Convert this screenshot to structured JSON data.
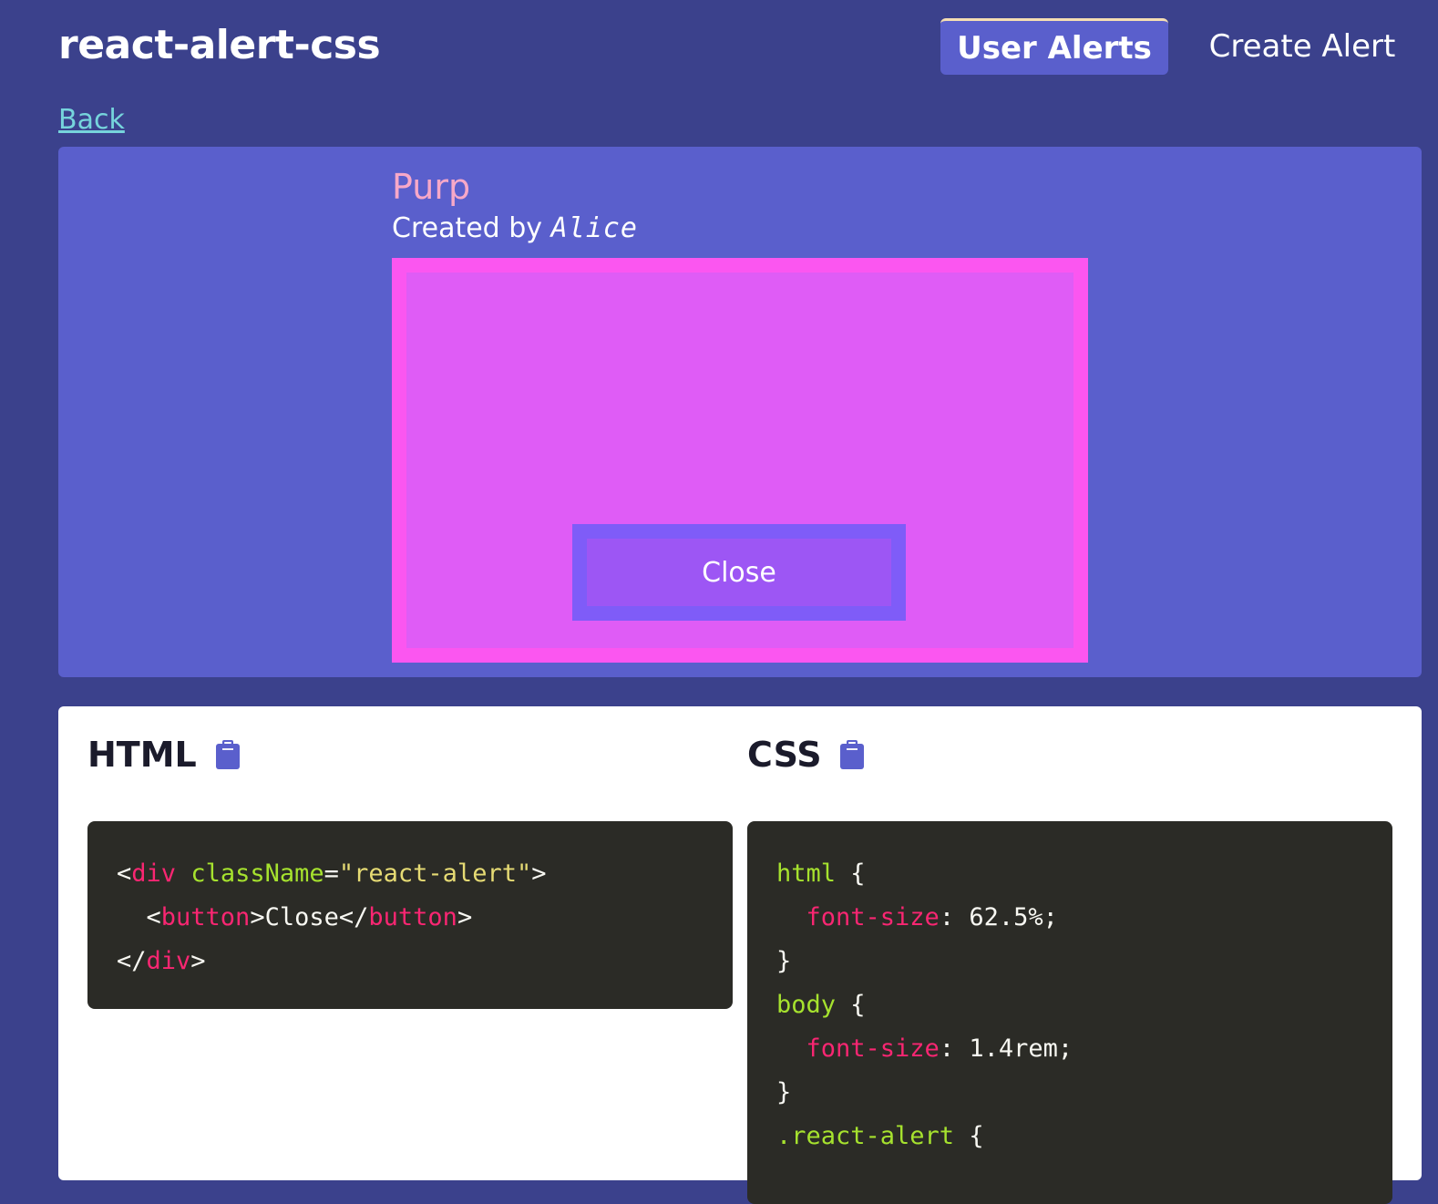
{
  "app": {
    "title": "react-alert-css"
  },
  "nav": {
    "user_alerts": "User Alerts",
    "create_alert": "Create Alert",
    "active": "User Alerts"
  },
  "back": {
    "label": "Back"
  },
  "alert": {
    "name": "Purp",
    "created_by_prefix": "Created by",
    "author": "Alice",
    "close_label": "Close",
    "colors": {
      "panel": "#5a5fcc",
      "alert_background": "#df5cf6",
      "alert_border": "#fb56f0",
      "button_background": "#9d56f4",
      "button_border": "#7f5cf8",
      "title": "#f7a8c8"
    }
  },
  "code": {
    "html_heading": "HTML",
    "css_heading": "CSS",
    "copy_icon": "clipboard-icon",
    "html_lines": [
      {
        "open": "<",
        "tag": "div",
        "sp": " ",
        "attr": "className",
        "eq": "=",
        "str": "\"react-alert\"",
        "close": ">"
      },
      {
        "indent": "  ",
        "open": "<",
        "tag": "button",
        "close": ">",
        "text": "Close",
        "open2": "</",
        "tag2": "button",
        "close2": ">"
      },
      {
        "open": "</",
        "tag": "div",
        "close": ">"
      }
    ],
    "css_lines": [
      {
        "type": "selector",
        "selector": "html",
        "brace": " {"
      },
      {
        "type": "decl",
        "indent": "  ",
        "prop": "font-size",
        "colon": ": ",
        "value": "62.5%;"
      },
      {
        "type": "close",
        "brace": "}"
      },
      {
        "type": "selector",
        "selector": "body",
        "brace": " {"
      },
      {
        "type": "decl",
        "indent": "  ",
        "prop": "font-size",
        "colon": ": ",
        "value": "1.4rem;"
      },
      {
        "type": "close",
        "brace": "}"
      },
      {
        "type": "selector",
        "selector": ".react-alert",
        "brace": " {"
      }
    ]
  }
}
